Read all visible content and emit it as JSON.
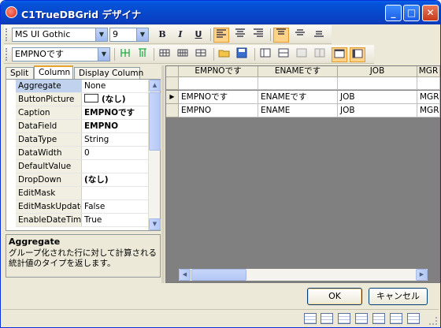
{
  "window": {
    "title": "C1TrueDBGrid デザイナ",
    "min": "_",
    "max": "□",
    "close": "✕"
  },
  "toolbar1": {
    "font_name": "MS UI Gothic",
    "font_size": "9",
    "bold": "B",
    "italic": "I",
    "underline": "U"
  },
  "toolbar2": {
    "column_select": "EMPNOです"
  },
  "tabs": [
    "Split",
    "Column",
    "Display Column"
  ],
  "properties": [
    {
      "name": "Aggregate",
      "value": "None",
      "bold": false,
      "box": false
    },
    {
      "name": "ButtonPicture",
      "value": "(なし)",
      "bold": true,
      "box": true
    },
    {
      "name": "Caption",
      "value": "EMPNOです",
      "bold": true,
      "box": false
    },
    {
      "name": "DataField",
      "value": "EMPNO",
      "bold": true,
      "box": false
    },
    {
      "name": "DataType",
      "value": "String",
      "bold": false,
      "box": false
    },
    {
      "name": "DataWidth",
      "value": "0",
      "bold": false,
      "box": false
    },
    {
      "name": "DefaultValue",
      "value": "",
      "bold": false,
      "box": false
    },
    {
      "name": "DropDown",
      "value": "(なし)",
      "bold": true,
      "box": false
    },
    {
      "name": "EditMask",
      "value": "",
      "bold": false,
      "box": false
    },
    {
      "name": "EditMaskUpdate",
      "value": "False",
      "bold": false,
      "box": false
    },
    {
      "name": "EnableDateTime",
      "value": "True",
      "bold": false,
      "box": false
    }
  ],
  "description": {
    "title": "Aggregate",
    "text": "グループ化された行に対して計算される統計値のタイプを返します。"
  },
  "grid": {
    "columns": [
      "EMPNOです",
      "ENAMEです",
      "JOB",
      "MGR"
    ],
    "rows": [
      [
        "EMPNOです",
        "ENAMEです",
        "JOB",
        "MGR"
      ],
      [
        "EMPNO",
        "ENAME",
        "JOB",
        "MGR"
      ]
    ],
    "current_row_marker": "▶"
  },
  "buttons": {
    "ok": "OK",
    "cancel": "キャンセル"
  }
}
